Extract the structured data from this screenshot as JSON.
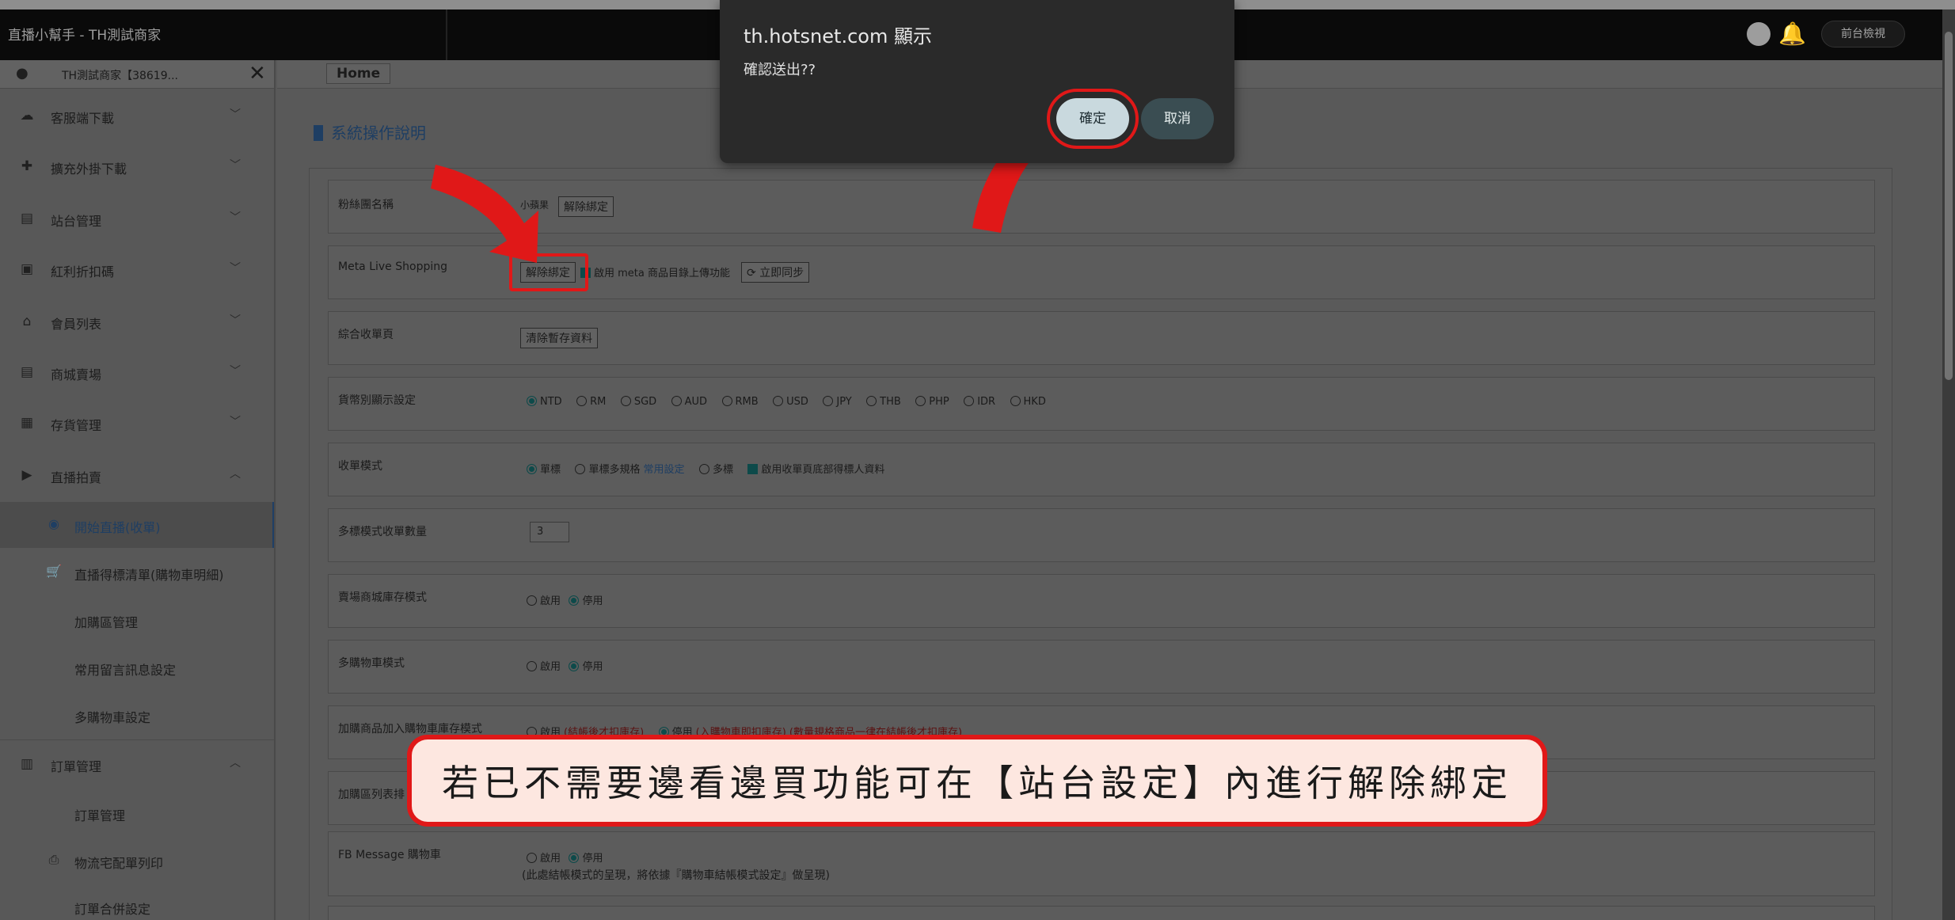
{
  "app": {
    "title": "直播小幫手 - TH測試商家",
    "front_button": "前台檢視"
  },
  "sidebar": {
    "user": "TH測試商家【38619...",
    "items": [
      {
        "label": "客服端下載",
        "icon": "cloud-download-icon"
      },
      {
        "label": "擴充外掛下載",
        "icon": "puzzle-icon"
      },
      {
        "label": "站台管理",
        "icon": "store-icon"
      },
      {
        "label": "紅利折扣碼",
        "icon": "ticket-icon"
      },
      {
        "label": "會員列表",
        "icon": "member-icon"
      },
      {
        "label": "商城賣場",
        "icon": "shop-icon"
      },
      {
        "label": "存貨管理",
        "icon": "inventory-icon"
      },
      {
        "label": "直播拍賣",
        "icon": "video-icon"
      }
    ],
    "live_sub": [
      {
        "label": "開始直播(收單)",
        "icon": "play-icon"
      },
      {
        "label": "直播得標清單(購物車明細)",
        "icon": "cart-icon"
      },
      {
        "label": "加購區管理"
      },
      {
        "label": "常用留言訊息設定"
      },
      {
        "label": "多購物車設定"
      }
    ],
    "order": {
      "label": "訂單管理",
      "icon": "clipboard-icon"
    },
    "order_sub": [
      {
        "label": "訂單管理"
      },
      {
        "label": "物流宅配單列印",
        "icon": "printer-icon"
      },
      {
        "label": "訂單合併設定"
      }
    ]
  },
  "breadcrumb": {
    "home": "Home"
  },
  "section_title": "系統操作說明",
  "settings": {
    "row1": {
      "label": "粉絲團名稱",
      "value": "小蘋果",
      "button": "解除綁定"
    },
    "row2": {
      "label": "Meta Live Shopping",
      "button": "解除綁定",
      "check_label": "啟用 meta 商品目錄上傳功能",
      "sync": "立即同步"
    },
    "row3": {
      "label": "綜合收單頁",
      "button": "清除暫存資料"
    },
    "row4": {
      "label": "貨幣別顯示設定",
      "options": [
        "NTD",
        "RM",
        "SGD",
        "AUD",
        "RMB",
        "USD",
        "JPY",
        "THB",
        "PHP",
        "IDR",
        "HKD"
      ]
    },
    "row5": {
      "label": "收單模式",
      "opt1": "單標",
      "opt2": "單標多規格",
      "opt2_link": "常用設定",
      "opt3": "多標",
      "check": "啟用收單頁底部得標人資料"
    },
    "row6": {
      "label": "多標模式收單數量",
      "value": "3"
    },
    "row7": {
      "label": "賣場商城庫存模式",
      "on": "啟用",
      "off": "停用"
    },
    "row8": {
      "label": "多購物車模式",
      "on": "啟用",
      "off": "停用"
    },
    "row9": {
      "label": "加購商品加入購物車庫存模式",
      "on": "啟用",
      "on_note": "(結帳後才扣庫存)",
      "off": "停用",
      "off_note": "(入購物車即扣庫存) (數量規格商品一律在結帳後才扣庫存)"
    },
    "row10": {
      "label": "加購區列表排"
    },
    "row11": {
      "label": "FB Message 購物車",
      "on": "啟用",
      "off": "停用",
      "note": "(此處結帳模式的呈現，將依據『購物車結帳模式設定』做呈現)"
    }
  },
  "dialog": {
    "host": "th.hotsnet.com 顯示",
    "message": "確認送出??",
    "ok": "確定",
    "cancel": "取消"
  },
  "callout": "若已不需要邊看邊買功能可在【站台設定】內進行解除綁定",
  "colors": {
    "accent_red": "#e01818",
    "callout_bg": "#fde7e0",
    "dialog_bg": "#2a2a2a",
    "active_blue": "#1e3e63"
  }
}
